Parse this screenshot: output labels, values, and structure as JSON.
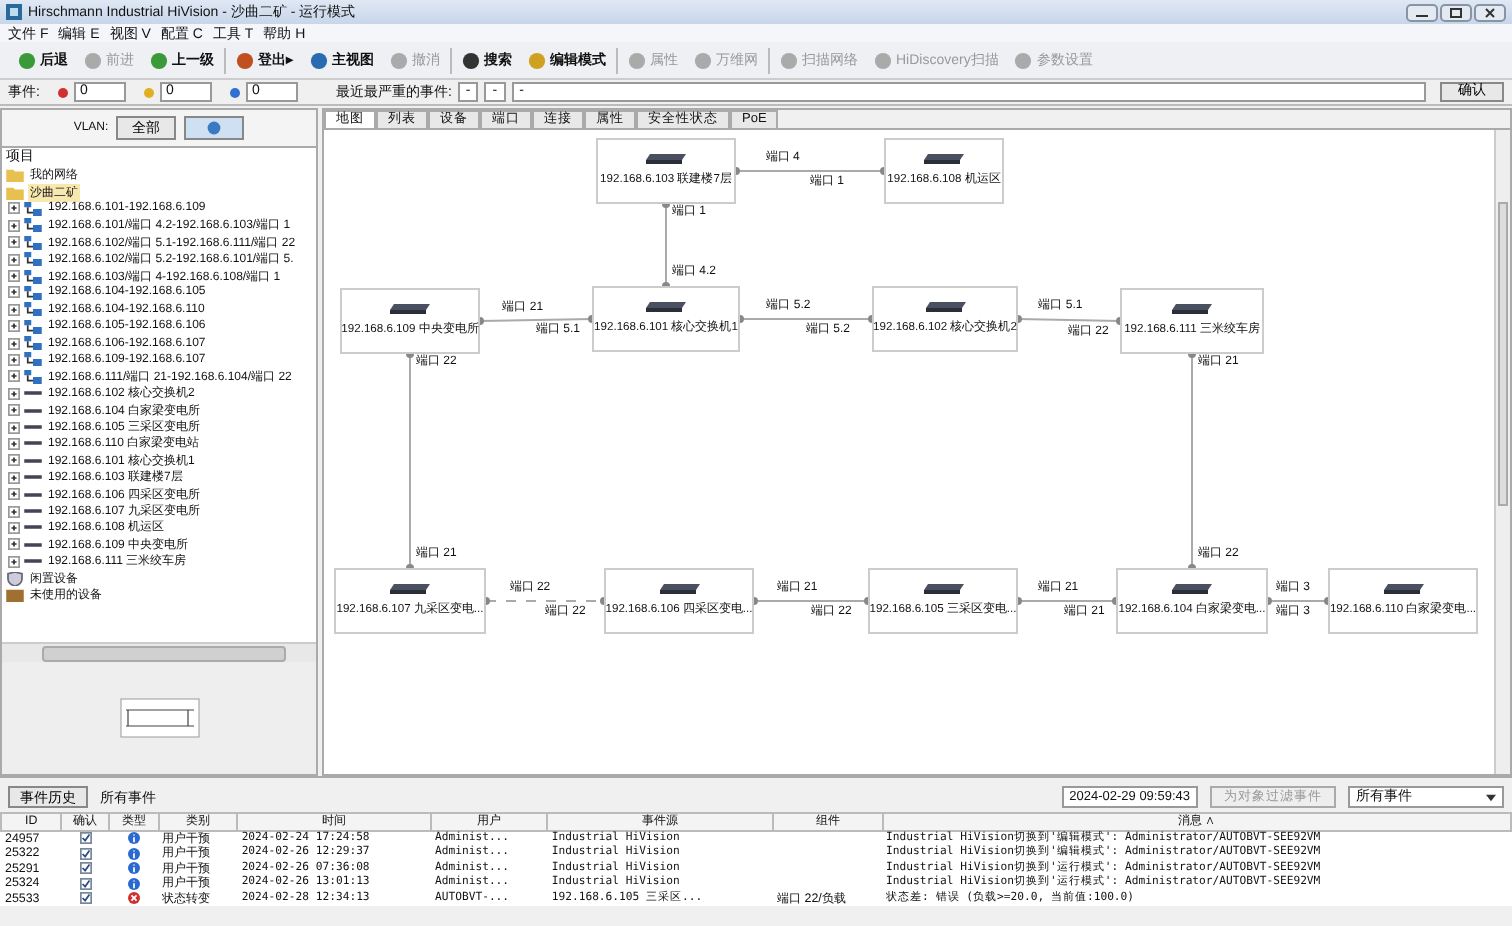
{
  "window": {
    "title": "Hirschmann Industrial HiVision - 沙曲二矿 - 运行模式"
  },
  "menu": [
    "文件 F",
    "编辑 E",
    "视图 V",
    "配置 C",
    "工具 T",
    "帮助 H"
  ],
  "toolbar": [
    {
      "label": "后退",
      "disabled": false
    },
    {
      "label": "前进",
      "disabled": true
    },
    {
      "label": "上一级",
      "disabled": false
    },
    {
      "label": "登出▸",
      "disabled": false
    },
    {
      "label": "主视图",
      "disabled": false
    },
    {
      "label": "撤消",
      "disabled": true
    },
    {
      "label": "搜索",
      "disabled": false
    },
    {
      "label": "编辑模式",
      "disabled": false
    },
    {
      "label": "属性",
      "disabled": true
    },
    {
      "label": "万维网",
      "disabled": true
    },
    {
      "label": "扫描网络",
      "disabled": true
    },
    {
      "label": "HiDiscovery扫描",
      "disabled": true
    },
    {
      "label": "参数设置",
      "disabled": true
    }
  ],
  "event_bar": {
    "label": "事件:",
    "counters": [
      {
        "kind": "error",
        "count": "0"
      },
      {
        "kind": "warning",
        "count": "0"
      },
      {
        "kind": "info",
        "count": "0"
      }
    ],
    "recent_label": "最近最严重的事件:",
    "recent": [
      "-",
      "-",
      "-"
    ],
    "confirm_button": "确认"
  },
  "vlan": {
    "label": "VLAN:",
    "button": "全部"
  },
  "tree": {
    "header": "项目",
    "items": [
      {
        "label": "我的网络",
        "kind": "folder",
        "selected": false
      },
      {
        "label": "沙曲二矿",
        "kind": "folder",
        "selected": true,
        "children": [
          {
            "label": "192.168.6.101-192.168.6.109",
            "kind": "link"
          },
          {
            "label": "192.168.6.101/端口 4.2-192.168.6.103/端口 1",
            "kind": "link"
          },
          {
            "label": "192.168.6.102/端口 5.1-192.168.6.111/端口 22",
            "kind": "link"
          },
          {
            "label": "192.168.6.102/端口 5.2-192.168.6.101/端口 5.",
            "kind": "link"
          },
          {
            "label": "192.168.6.103/端口 4-192.168.6.108/端口 1",
            "kind": "link"
          },
          {
            "label": "192.168.6.104-192.168.6.105",
            "kind": "link"
          },
          {
            "label": "192.168.6.104-192.168.6.110",
            "kind": "link"
          },
          {
            "label": "192.168.6.105-192.168.6.106",
            "kind": "link"
          },
          {
            "label": "192.168.6.106-192.168.6.107",
            "kind": "link"
          },
          {
            "label": "192.168.6.109-192.168.6.107",
            "kind": "link"
          },
          {
            "label": "192.168.6.111/端口 21-192.168.6.104/端口 22",
            "kind": "link"
          },
          {
            "label": "192.168.6.102 核心交换机2",
            "kind": "device"
          },
          {
            "label": "192.168.6.104 白家梁变电所",
            "kind": "device"
          },
          {
            "label": "192.168.6.105 三采区变电所",
            "kind": "device"
          },
          {
            "label": "192.168.6.110 白家梁变电站",
            "kind": "device"
          },
          {
            "label": "192.168.6.101 核心交换机1",
            "kind": "device"
          },
          {
            "label": "192.168.6.103 联建楼7层",
            "kind": "device"
          },
          {
            "label": "192.168.6.106 四采区变电所",
            "kind": "device"
          },
          {
            "label": "192.168.6.107 九采区变电所",
            "kind": "device"
          },
          {
            "label": "192.168.6.108 机运区",
            "kind": "device"
          },
          {
            "label": "192.168.6.109 中央变电所",
            "kind": "device"
          },
          {
            "label": "192.168.6.111 三米绞车房",
            "kind": "device"
          }
        ]
      },
      {
        "label": "闲置设备",
        "kind": "idle",
        "selected": false
      },
      {
        "label": "未使用的设备",
        "kind": "unused",
        "selected": false
      }
    ]
  },
  "tabs": [
    {
      "label": "地图",
      "selected": true
    },
    {
      "label": "列表",
      "selected": false
    },
    {
      "label": "设备",
      "selected": false
    },
    {
      "label": "端口",
      "selected": false
    },
    {
      "label": "连接",
      "selected": false
    },
    {
      "label": "属性",
      "selected": false
    },
    {
      "label": "安全性状态",
      "selected": false
    },
    {
      "label": "PoE",
      "selected": false
    }
  ],
  "map": {
    "nodes": [
      {
        "label": "192.168.6.103 联建楼7层"
      },
      {
        "label": "192.168.6.108 机运区"
      },
      {
        "label": "192.168.6.109 中央变电所"
      },
      {
        "label": "192.168.6.101 核心交换机1"
      },
      {
        "label": "192.168.6.102 核心交换机2"
      },
      {
        "label": "192.168.6.111 三米绞车房"
      },
      {
        "label": "192.168.6.107 九采区变电..."
      },
      {
        "label": "192.168.6.106 四采区变电..."
      },
      {
        "label": "192.168.6.105 三采区变电..."
      },
      {
        "label": "192.168.6.104 白家梁变电..."
      },
      {
        "label": "192.168.6.110 白家梁变电..."
      }
    ],
    "links": [
      {
        "from_port": "端口 4",
        "to_port": "端口 1"
      },
      {
        "from_port": "端口 1",
        "to_port": "端口 4.2"
      },
      {
        "from_port": "端口 21",
        "to_port": "端口 5.1"
      },
      {
        "from_port": "端口 5.2",
        "to_port": "端口 5.2"
      },
      {
        "from_port": "端口 5.1",
        "to_port": "端口 22"
      },
      {
        "from_port": "端口 22",
        "to_port": "端口 21"
      },
      {
        "from_port": "端口 21",
        "to_port": "端口 22"
      },
      {
        "from_port": "端口 22",
        "to_port": "端口 22"
      },
      {
        "from_port": "端口 21",
        "to_port": "端口 22"
      },
      {
        "from_port": "端口 21",
        "to_port": "端口 21"
      },
      {
        "from_port": "端口 3",
        "to_port": "端口 3"
      }
    ]
  },
  "events": {
    "history_button": "事件历史",
    "title": "所有事件",
    "date": "2024-02-29 09:59:43",
    "filter_button": {
      "label": "为对象过滤事件",
      "disabled": true
    },
    "filter_select": "所有事件",
    "columns": [
      "ID",
      "确认",
      "类型",
      "类别",
      "时间",
      "用户",
      "事件源",
      "组件",
      "消息 ∧"
    ],
    "rows": [
      {
        "id": "24957",
        "confirmed": true,
        "kind": "info",
        "category": "用户干预",
        "time": "2024-02-24 17:24:58",
        "user": "Administ...",
        "source": "Industrial HiVision",
        "component": "",
        "message": "Industrial HiVision切换到'编辑模式': Administrator/AUTOBVT-SEE92VM"
      },
      {
        "id": "25322",
        "confirmed": true,
        "kind": "info",
        "category": "用户干预",
        "time": "2024-02-26 12:29:37",
        "user": "Administ...",
        "source": "Industrial HiVision",
        "component": "",
        "message": "Industrial HiVision切换到'编辑模式': Administrator/AUTOBVT-SEE92VM"
      },
      {
        "id": "25291",
        "confirmed": true,
        "kind": "info",
        "category": "用户干预",
        "time": "2024-02-26 07:36:08",
        "user": "Administ...",
        "source": "Industrial HiVision",
        "component": "",
        "message": "Industrial HiVision切换到'运行模式': Administrator/AUTOBVT-SEE92VM"
      },
      {
        "id": "25324",
        "confirmed": true,
        "kind": "info",
        "category": "用户干预",
        "time": "2024-02-26 13:01:13",
        "user": "Administ...",
        "source": "Industrial HiVision",
        "component": "",
        "message": "Industrial HiVision切换到'运行模式': Administrator/AUTOBVT-SEE92VM"
      },
      {
        "id": "25533",
        "confirmed": true,
        "kind": "error",
        "category": "状态转变",
        "time": "2024-02-28 12:34:13",
        "user": "AUTOBVT-...",
        "source": "192.168.6.105 三采区...",
        "component": "端口 22/负载",
        "message": "状态差: 错误 (负载>=20.0, 当前值:100.0)"
      }
    ]
  }
}
